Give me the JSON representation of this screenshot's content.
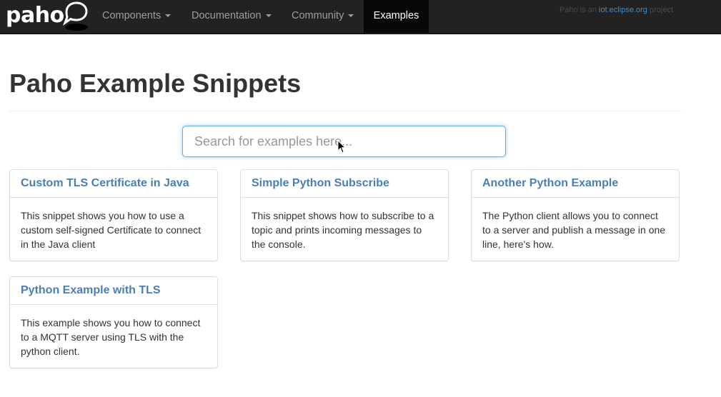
{
  "brand": {
    "name": "paho"
  },
  "nav": {
    "items": [
      {
        "label": "Components",
        "dropdown": true
      },
      {
        "label": "Documentation",
        "dropdown": true
      },
      {
        "label": "Community",
        "dropdown": true
      },
      {
        "label": "Examples",
        "active": true
      }
    ],
    "note": {
      "prefix": "Paho is an ",
      "link": "iot.eclipse.org",
      "suffix": " project"
    }
  },
  "page": {
    "title": "Paho Example Snippets"
  },
  "search": {
    "placeholder": "Search for examples here..."
  },
  "cards": [
    {
      "title": "Custom TLS Certificate in Java",
      "body": "This snippet shows you how to use a custom self-signed Certificate to connect in the Java client"
    },
    {
      "title": "Simple Python Subscribe",
      "body": "This snippet shows how to subscribe to a topic and prints incoming messages to the console."
    },
    {
      "title": "Another Python Example",
      "body": "The Python client allows you to connect to a server and publish a message in one line, here's how."
    },
    {
      "title": "Python Example with TLS",
      "body": "This example shows you how to connect to a MQTT server using TLS with the python client."
    }
  ],
  "colors": {
    "navbar": "#222222",
    "link": "#4a7fb5",
    "focus_border": "#66afe9"
  }
}
